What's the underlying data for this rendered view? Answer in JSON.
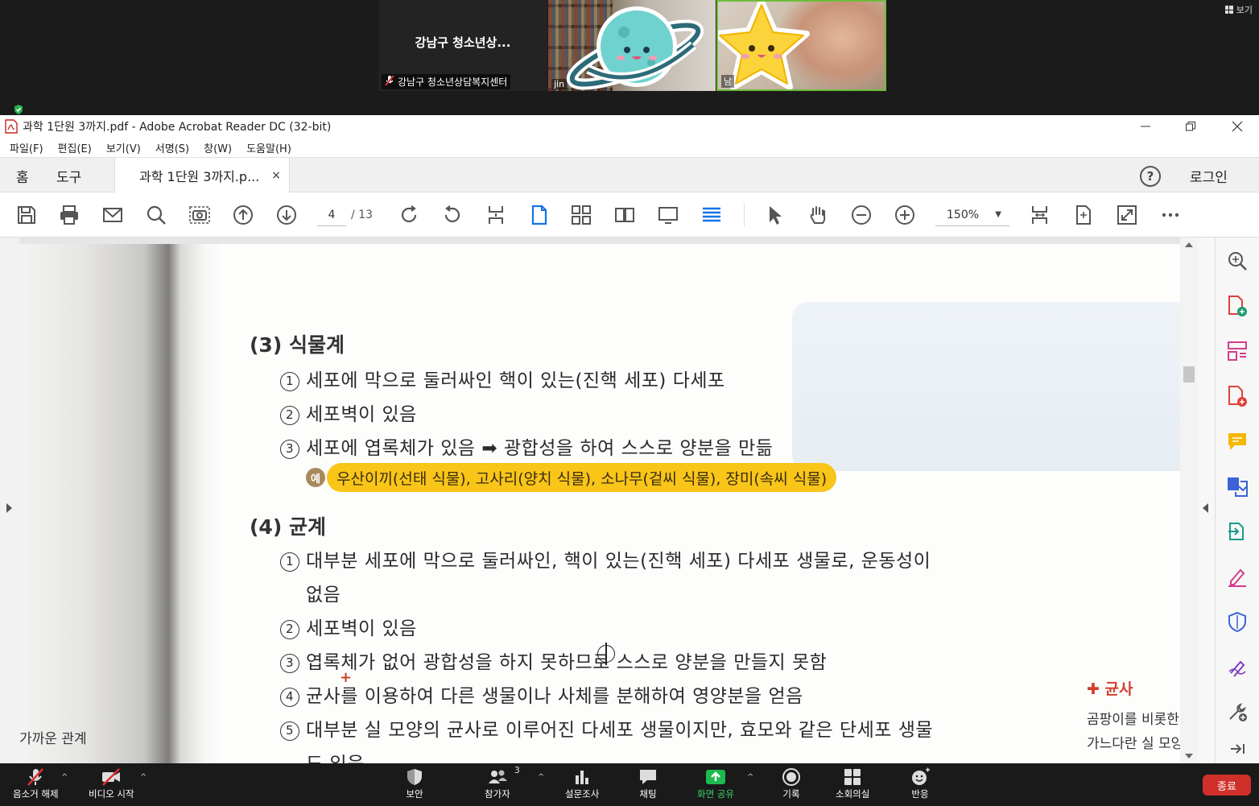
{
  "zoom": {
    "tiles": [
      {
        "title": "강남구 청소년상...",
        "name": "강남구 청소년상담복지센터"
      },
      {
        "name": "jin"
      },
      {
        "name": "남"
      }
    ],
    "view_label": "보기",
    "bottom_bar": {
      "mute": "음소거 해제",
      "video": "비디오 시작",
      "security": "보안",
      "participants": "참가자",
      "participants_count": "3",
      "poll": "설문조사",
      "chat": "채팅",
      "share_screen": "화면 공유",
      "record": "기록",
      "breakout": "소회의실",
      "reactions": "반응",
      "end": "종료"
    }
  },
  "acrobat": {
    "window_title": "과학 1단원 3까지.pdf - Adobe Acrobat Reader DC (32-bit)",
    "menu": [
      "파일(F)",
      "편집(E)",
      "보기(V)",
      "서명(S)",
      "창(W)",
      "도움말(H)"
    ],
    "tabs": {
      "home": "홈",
      "tools": "도구",
      "document": "과학 1단원 3까지.p...",
      "close": "×"
    },
    "help": "?",
    "login": "로그인",
    "page_current": "4",
    "page_total": "/ 13",
    "zoom_level": "150%"
  },
  "document": {
    "section3_title": "(3) 식물계",
    "section3_items": [
      {
        "num": "1",
        "text": "세포에 막으로 둘러싸인 핵이 있는(진핵 세포) 다세포"
      },
      {
        "num": "2",
        "text": "세포벽이 있음"
      },
      {
        "num": "3",
        "text": "세포에 엽록체가 있음 ➡ 광합성을 하여 스스로 양분을 만듦"
      }
    ],
    "example_badge": "예",
    "example_text": "우산이끼(선태 식물), 고사리(양치 식물), 소나무(겉씨 식물), 장미(속씨 식물)",
    "section4_title": "(4) 균계",
    "section4_items": [
      {
        "num": "1",
        "text": "대부분 세포에 막으로 둘러싸인, 핵이 있는(진핵 세포) 다세포 생물로, 운동성이",
        "cont": "없음"
      },
      {
        "num": "2",
        "text": "세포벽이 있음"
      },
      {
        "num": "3",
        "text": "엽록체가 없어 광합성을 하지 못하므로 스스로 양분을 만들지 못함"
      },
      {
        "num": "4",
        "text": "균사를 이용하여 다른 생물이나 사체를 분해하여 영양분을 얻음"
      },
      {
        "num": "5",
        "text": "대부분 실 모양의 균사로 이루어진 다세포 생물이지만, 효모와 같은 단세포 생물",
        "cont": "도 있음"
      }
    ],
    "left_margin_text": "가까운 관계",
    "side_note_title": "✚ 균사",
    "side_note_lines": [
      "곰팡이를 비롯한",
      "가느다란 실 모양"
    ]
  }
}
